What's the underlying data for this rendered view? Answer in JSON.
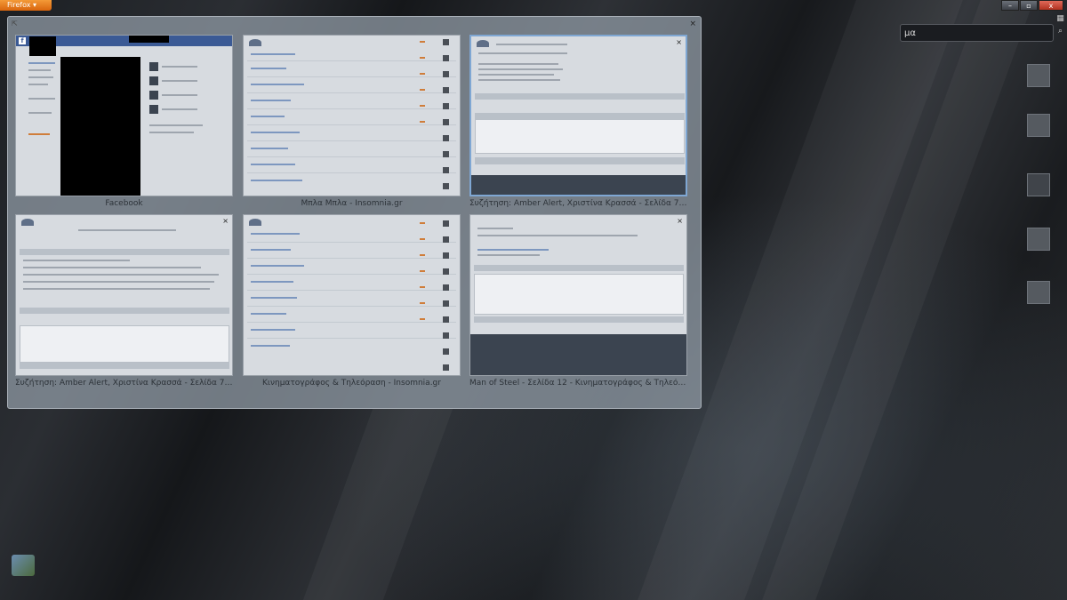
{
  "browser": {
    "app_button_label": "Firefox",
    "controls": [
      "–",
      "▫",
      "x"
    ],
    "search_value": "μα"
  },
  "panorama": {
    "tabs": [
      {
        "title": "Facebook"
      },
      {
        "title": "Μπλα Μπλα - Insomnia.gr"
      },
      {
        "title": "Συζήτηση: Amber Alert, Χριστίνα Κρασσά - Σελίδα 7 - ..."
      },
      {
        "title": "Συζήτηση: Amber Alert, Χριστίνα Κρασσά - Σελίδα 7 - ..."
      },
      {
        "title": "Κινηματογράφος & Τηλεόραση - Insomnia.gr"
      },
      {
        "title": "Man of Steel - Σελίδα 12 - Κινηματογράφος & Τηλεόρ..."
      }
    ]
  },
  "icons": {
    "panel_close": "×",
    "thumb_close": "×",
    "panel_grip": "⇱",
    "search_glyph": "⌕",
    "group_glyph": "▦",
    "menu_glyph": "▾"
  },
  "colors": {
    "firefox_orange": "#e07a1f",
    "active_tab_border": "#7fa7d3",
    "facebook_blue": "#3b5a95"
  }
}
